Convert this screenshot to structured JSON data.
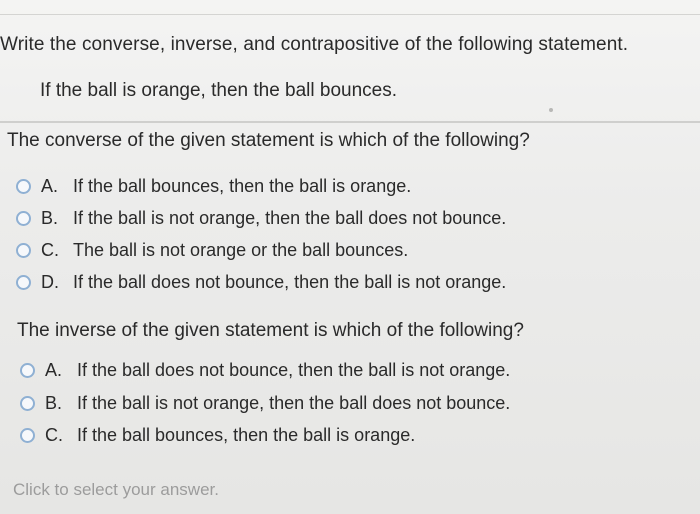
{
  "question": {
    "title": "Write the converse, inverse, and contrapositive of the following statement.",
    "statement": "If the ball is orange, then the ball bounces."
  },
  "converse": {
    "prompt": "The converse of the given statement is which of the following?",
    "options": [
      {
        "letter": "A.",
        "text": "If the ball bounces, then the ball is orange."
      },
      {
        "letter": "B.",
        "text": "If the ball is not orange, then the ball does not bounce."
      },
      {
        "letter": "C.",
        "text": "The ball is not orange or the ball bounces."
      },
      {
        "letter": "D.",
        "text": "If the ball does not bounce, then the ball is not orange."
      }
    ]
  },
  "inverse": {
    "prompt": "The inverse of the given statement is which of the following?",
    "options": [
      {
        "letter": "A.",
        "text": "If the ball does not bounce, then the ball is not orange."
      },
      {
        "letter": "B.",
        "text": "If the ball is not orange, then the ball does not bounce."
      },
      {
        "letter": "C.",
        "text": "If the ball bounces, then the ball is orange."
      }
    ]
  },
  "footer": {
    "hint": "Click to select your answer."
  },
  "colors": {
    "radio_border": "#8fb0d3",
    "text": "#2a2a2a",
    "hint": "#9c9c9c"
  }
}
